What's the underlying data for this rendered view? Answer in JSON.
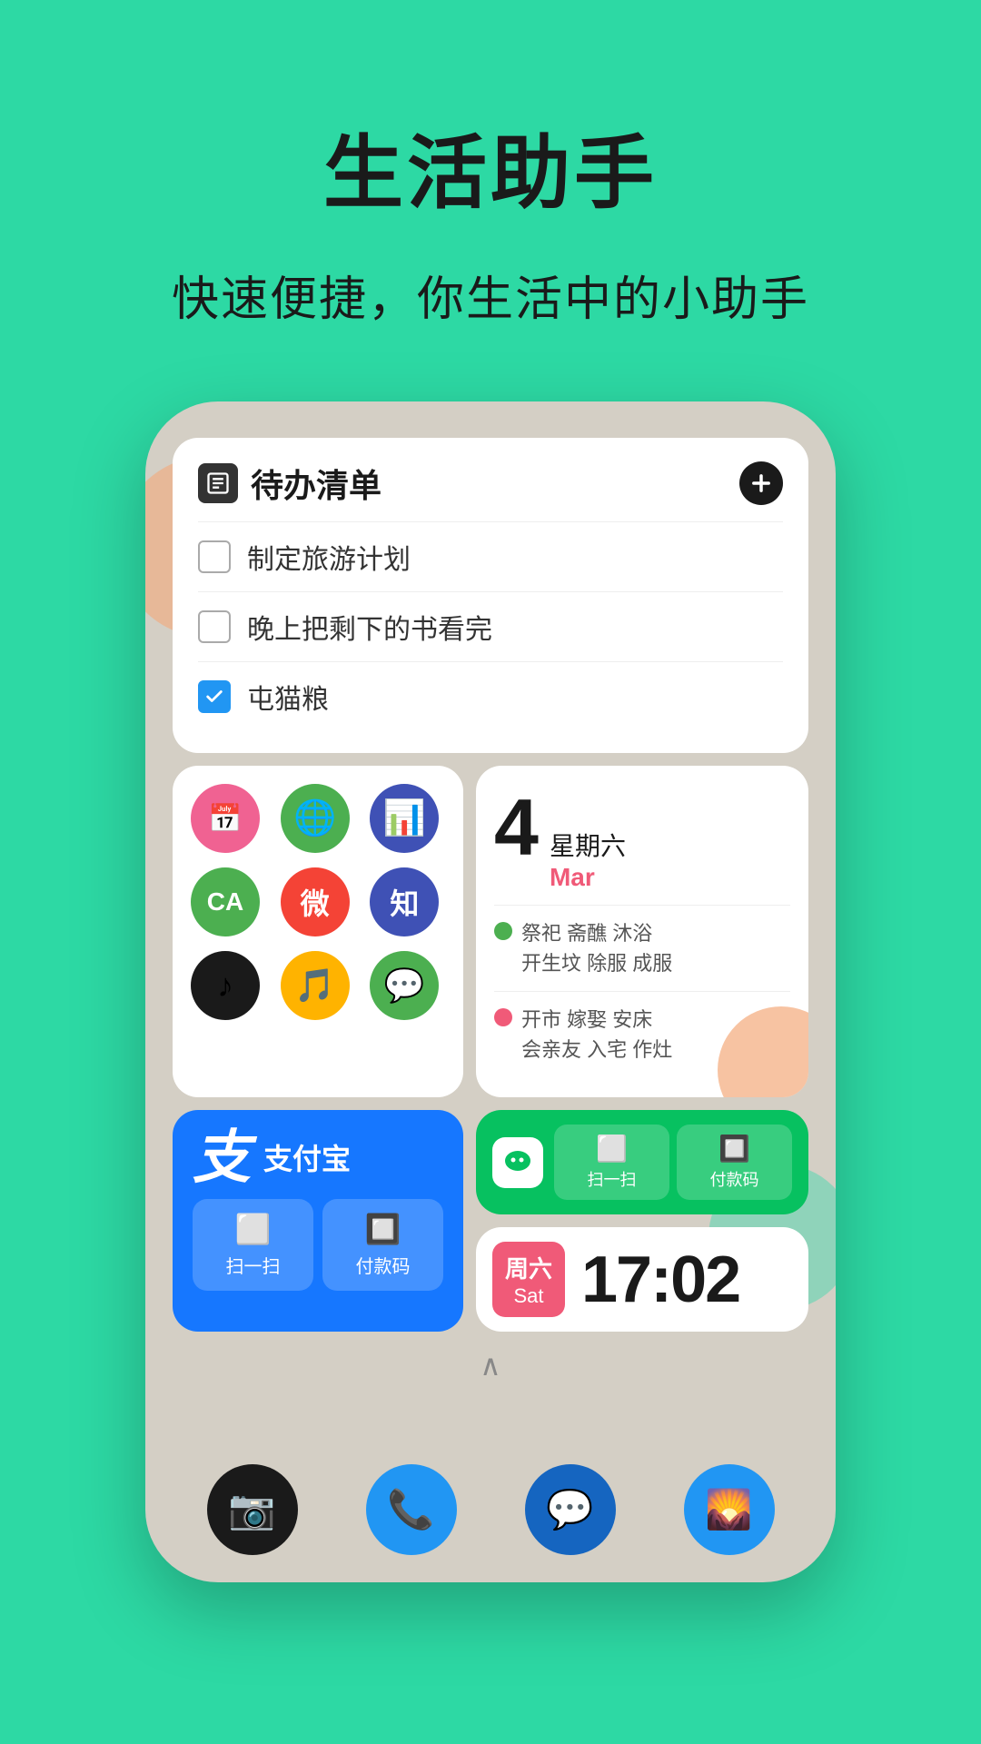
{
  "header": {
    "title": "生活助手",
    "subtitle": "快速便捷，你生活中的小助手"
  },
  "todo_widget": {
    "title": "待办清单",
    "add_button_label": "+",
    "items": [
      {
        "text": "制定旅游计划",
        "checked": false
      },
      {
        "text": "晚上把剩下的书看完",
        "checked": false
      },
      {
        "text": "屯猫粮",
        "checked": true
      }
    ]
  },
  "apps_widget": {
    "apps": [
      {
        "name": "media-app",
        "bg": "#f06292",
        "icon": "📅"
      },
      {
        "name": "chrome-app",
        "bg": "#4caf50",
        "icon": "🌐"
      },
      {
        "name": "analytics-app",
        "bg": "#3f51b5",
        "icon": "📊"
      },
      {
        "name": "ca-app",
        "bg": "#4caf50",
        "icon": "CA"
      },
      {
        "name": "weibo-app",
        "bg": "#f44336",
        "icon": "微"
      },
      {
        "name": "zhihu-app",
        "bg": "#3f51b5",
        "icon": "知"
      },
      {
        "name": "tiktok-app",
        "bg": "#1a1a1a",
        "icon": "♪"
      },
      {
        "name": "music-app",
        "bg": "#ffb300",
        "icon": "🎵"
      },
      {
        "name": "wechat-app",
        "bg": "#4caf50",
        "icon": "💬"
      }
    ]
  },
  "calendar_widget": {
    "date_num": "4",
    "weekday": "星期六",
    "month": "Mar",
    "good_events": "祭祀  斋醮  沐浴\n开生坟  除服  成服",
    "bad_events": "开市  嫁娶  安床\n会亲友  入宅  作灶"
  },
  "alipay_widget": {
    "logo": "支",
    "name": "支付宝",
    "scan_label": "扫一扫",
    "pay_label": "付款码"
  },
  "wechat_widget": {
    "scan_label": "扫一扫",
    "pay_label": "付款码"
  },
  "clock_widget": {
    "weekday": "周六",
    "day_name": "Sat",
    "time": "17:02"
  },
  "dock": {
    "items": [
      {
        "name": "camera",
        "bg": "#1a1a1a",
        "icon": "📷"
      },
      {
        "name": "phone",
        "bg": "#2196f3",
        "icon": "📞"
      },
      {
        "name": "messages",
        "bg": "#1565c0",
        "icon": "💬"
      },
      {
        "name": "photos",
        "bg": "#2196f3",
        "icon": "🌄"
      }
    ]
  },
  "colors": {
    "bg_green": "#2dd9a4",
    "alipay_blue": "#1677ff",
    "wechat_green": "#07c160",
    "clock_red": "#f05a78",
    "todo_add_dark": "#1a1a1a"
  }
}
